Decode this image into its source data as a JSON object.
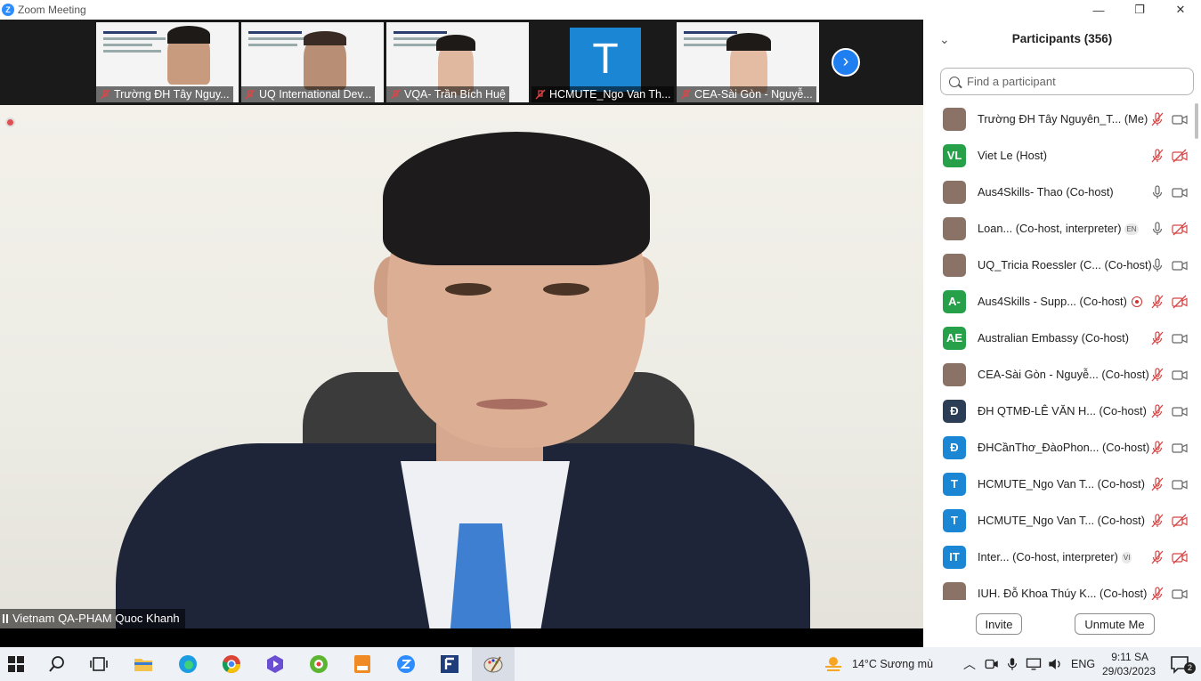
{
  "window": {
    "title": "Zoom Meeting",
    "minimize": "—",
    "maximize": "❐",
    "close": "✕"
  },
  "gallery": {
    "thumbs": [
      {
        "name": "Trường ĐH Tây Nguy..."
      },
      {
        "name": "UQ International Dev..."
      },
      {
        "name": "VQA- Trần Bích Huệ"
      },
      {
        "name": "HCMUTE_Ngo Van Th...",
        "initial": "T"
      },
      {
        "name": "CEA-Sài Gòn - Nguyễ..."
      }
    ],
    "next_label": "›"
  },
  "main_video": {
    "speaker_name": "Vietnam QA-PHAM Quoc Khanh"
  },
  "participants": {
    "title": "Participants (356)",
    "search_placeholder": "Find a participant",
    "rows": [
      {
        "name": "Trường ĐH Tây Nguyên_T...",
        "role": " (Me)",
        "avatar": "",
        "avatar_color": "#8a7366",
        "muted": true,
        "video_off": false,
        "badge": "",
        "recording": false
      },
      {
        "name": "Viet Le",
        "role": " (Host)",
        "avatar": "VL",
        "avatar_color": "#27a04a",
        "muted": true,
        "video_off": true,
        "badge": "",
        "recording": false
      },
      {
        "name": "Aus4Skills- Thao",
        "role": " (Co-host)",
        "avatar": "",
        "avatar_color": "#8a7366",
        "muted": false,
        "video_off": false,
        "badge": "",
        "recording": false
      },
      {
        "name": "Loan...",
        "role": "  (Co-host, interpreter)",
        "avatar": "",
        "avatar_color": "#8a7366",
        "muted": false,
        "video_off": true,
        "badge": "EN",
        "recording": false
      },
      {
        "name": "UQ_Tricia Roessler (C...",
        "role": " (Co-host)",
        "avatar": "",
        "avatar_color": "#8a7366",
        "muted": false,
        "video_off": false,
        "badge": "",
        "recording": false
      },
      {
        "name": "Aus4Skills - Supp...",
        "role": " (Co-host)",
        "avatar": "A-",
        "avatar_color": "#27a04a",
        "muted": true,
        "video_off": true,
        "badge": "",
        "recording": true
      },
      {
        "name": "Australian Embassy",
        "role": " (Co-host)",
        "avatar": "AE",
        "avatar_color": "#27a04a",
        "muted": true,
        "video_off": false,
        "badge": "",
        "recording": false
      },
      {
        "name": "CEA-Sài Gòn - Nguyễ...",
        "role": " (Co-host)",
        "avatar": "",
        "avatar_color": "#8a7366",
        "muted": true,
        "video_off": false,
        "badge": "",
        "recording": false
      },
      {
        "name": "ĐH QTMĐ-LÊ VĂN H...",
        "role": " (Co-host)",
        "avatar": "Đ",
        "avatar_color": "#2c3e55",
        "muted": true,
        "video_off": false,
        "badge": "",
        "recording": false
      },
      {
        "name": "ĐHCầnThơ_ĐàoPhon...",
        "role": " (Co-host)",
        "avatar": "Đ",
        "avatar_color": "#1a86d4",
        "muted": true,
        "video_off": false,
        "badge": "",
        "recording": false
      },
      {
        "name": "HCMUTE_Ngo Van T...",
        "role": " (Co-host)",
        "avatar": "T",
        "avatar_color": "#1a86d4",
        "muted": true,
        "video_off": false,
        "badge": "",
        "recording": false
      },
      {
        "name": "HCMUTE_Ngo Van T...",
        "role": " (Co-host)",
        "avatar": "T",
        "avatar_color": "#1a86d4",
        "muted": true,
        "video_off": true,
        "badge": "",
        "recording": false
      },
      {
        "name": "Inter...",
        "role": "  (Co-host, interpreter)",
        "avatar": "IT",
        "avatar_color": "#1a86d4",
        "muted": true,
        "video_off": true,
        "badge": "VI",
        "recording": false
      },
      {
        "name": "IUH. Đỗ Khoa Thúy K...",
        "role": " (Co-host)",
        "avatar": "",
        "avatar_color": "#8a7366",
        "muted": true,
        "video_off": false,
        "badge": "",
        "recording": false
      }
    ],
    "invite_label": "Invite",
    "unmute_label": "Unmute Me"
  },
  "taskbar": {
    "weather": "14°C  Sương mù",
    "language": "ENG",
    "time": "9:11 SA",
    "date": "29/03/2023",
    "notification_count": "2"
  },
  "colors": {
    "zoom_blue": "#2d8cff",
    "muted_red": "#d64545",
    "panel_bg": "#ffffff"
  }
}
